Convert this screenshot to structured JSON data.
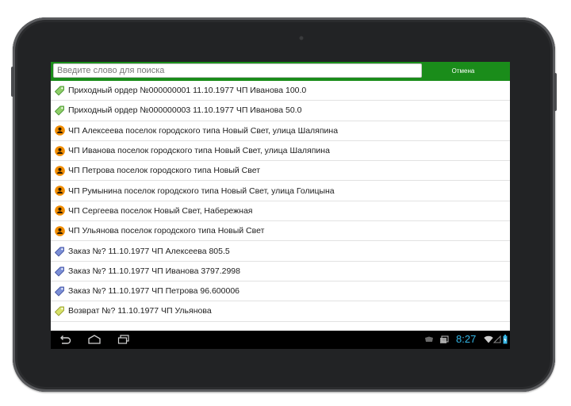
{
  "search": {
    "placeholder": "Введите слово для поиска",
    "cancel_label": "Отмена"
  },
  "items": [
    {
      "icon": "receipt-tag-green-icon",
      "text": "Приходный ордер №000000001 11.10.1977  ЧП Иванова 100.0"
    },
    {
      "icon": "receipt-tag-green-icon",
      "text": "Приходный ордер №000000003 11.10.1977  ЧП Иванова 50.0"
    },
    {
      "icon": "person-orange-icon",
      "text": "ЧП Алексеева поселок городского типа Новый Свет, улица Шаляпина"
    },
    {
      "icon": "person-orange-icon",
      "text": "ЧП Иванова поселок городского типа Новый Свет, улица Шаляпина"
    },
    {
      "icon": "person-orange-icon",
      "text": "ЧП Петрова поселок городского типа Новый Свет"
    },
    {
      "icon": "person-orange-icon",
      "text": "ЧП Румынина поселок городского типа Новый Свет, улица Голицына"
    },
    {
      "icon": "person-orange-icon",
      "text": "ЧП Сергеева поселок Новый Свет, Набережная"
    },
    {
      "icon": "person-orange-icon",
      "text": "ЧП Ульянова поселок городского типа Новый Свет"
    },
    {
      "icon": "order-tag-blue-icon",
      "text": "Заказ №? 11.10.1977  ЧП Алексеева 805.5"
    },
    {
      "icon": "order-tag-blue-icon",
      "text": "Заказ №? 11.10.1977  ЧП Иванова 3797.2998"
    },
    {
      "icon": "order-tag-blue-icon",
      "text": "Заказ №? 11.10.1977  ЧП Петрова 96.600006"
    },
    {
      "icon": "return-tag-yellow-icon",
      "text": "Возврат №? 11.10.1977  ЧП Ульянова"
    }
  ],
  "status": {
    "time": "8:27"
  },
  "colors": {
    "search_bar_bg": "#1a8c1a",
    "clock": "#33b5e5",
    "person_icon": "#f08c00",
    "order_tag": "#7b8fd6",
    "receipt_tag": "#8fce6a",
    "return_tag": "#d8e26a"
  }
}
